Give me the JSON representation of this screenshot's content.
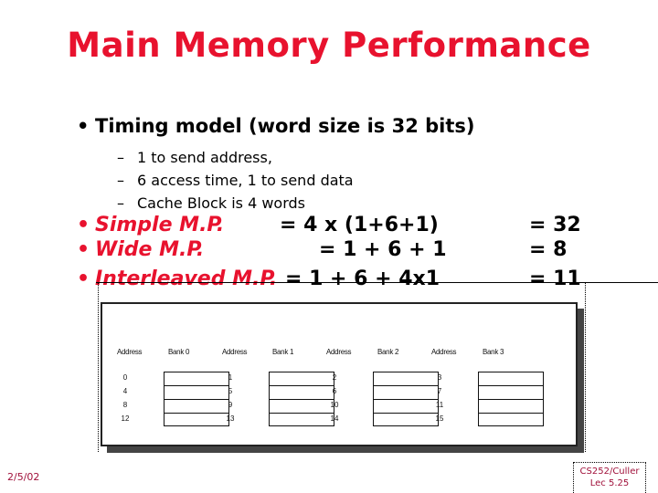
{
  "slide": {
    "title": "Main Memory Performance",
    "main_bullet": "Timing model (word size is 32 bits)",
    "sub_bullets": [
      "1 to send address,",
      "6 access time, 1 to send data",
      "Cache Block is 4 words"
    ],
    "formulas": [
      {
        "label": "Simple M.P.",
        "expr": "= 4 x (1+6+1)",
        "result": "= 32"
      },
      {
        "label": "Wide M.P.",
        "expr": "= 1 + 6 + 1",
        "result": "= 8"
      },
      {
        "label": "Interleaved M.P.",
        "expr": "= 1 + 6 + 4x1",
        "result": "= 11"
      }
    ],
    "bullet_glyph": "•",
    "dash_glyph": "–"
  },
  "figure": {
    "banks": [
      {
        "address_header": "Address",
        "bank_header": "Bank 0",
        "addresses": [
          "0",
          "4",
          "8",
          "12"
        ]
      },
      {
        "address_header": "Address",
        "bank_header": "Bank 1",
        "addresses": [
          "1",
          "5",
          "9",
          "13"
        ]
      },
      {
        "address_header": "Address",
        "bank_header": "Bank 2",
        "addresses": [
          "2",
          "6",
          "10",
          "14"
        ]
      },
      {
        "address_header": "Address",
        "bank_header": "Bank 3",
        "addresses": [
          "3",
          "7",
          "11",
          "15"
        ]
      }
    ]
  },
  "footer": {
    "date": "2/5/02",
    "course": "CS252/Culler",
    "lecture": "Lec 5.25"
  },
  "colors": {
    "title": "#e8122e",
    "footer": "#a0103a"
  }
}
